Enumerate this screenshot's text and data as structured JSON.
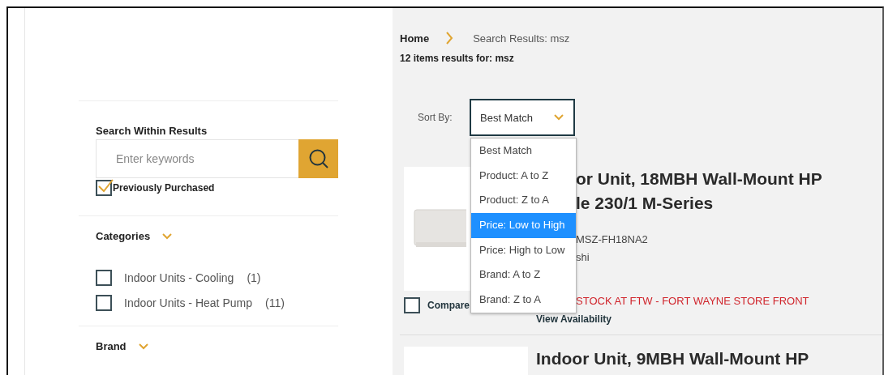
{
  "breadcrumb": [
    {
      "label": "Home",
      "kind": "link"
    },
    {
      "label": "Search Results: msz",
      "kind": "current"
    }
  ],
  "results_summary": "12 items results for: msz",
  "sidebar": {
    "search": {
      "title": "Search Within Results",
      "placeholder": "Enter keywords"
    },
    "previously_purchased": {
      "label": "Previously Purchased",
      "checked": true
    },
    "filters": [
      {
        "title": "Categories",
        "options": [
          {
            "label": "Indoor Units - Cooling",
            "count": "(1)",
            "checked": false
          },
          {
            "label": "Indoor Units - Heat Pump",
            "count": "(11)",
            "checked": false
          }
        ]
      },
      {
        "title": "Brand"
      }
    ]
  },
  "sort": {
    "label": "Sort By:",
    "value": "Best Match",
    "options": [
      {
        "label": "Best Match",
        "highlighted": false
      },
      {
        "label": "Product: A to Z",
        "highlighted": false
      },
      {
        "label": "Product: Z to A",
        "highlighted": false
      },
      {
        "label": "Price: Low to High",
        "highlighted": true
      },
      {
        "label": "Price: High to Low",
        "highlighted": false
      },
      {
        "label": "Brand: A to Z",
        "highlighted": false
      },
      {
        "label": "Brand: Z to A",
        "highlighted": false
      }
    ]
  },
  "products": [
    {
      "title_lines": [
        "or Unit, 18MBH Wall-Mount HP",
        "le 230/1 M-Series"
      ],
      "details": [
        "MSZ-FH18NA2",
        "shi"
      ],
      "stock": "STOCK AT FTW - FORT WAYNE STORE FRONT",
      "availability_link": "View Availability",
      "compare": {
        "label": "Compare",
        "checked": false
      }
    },
    {
      "title_lines": [
        "Indoor Unit, 9MBH Wall-Mount HP"
      ]
    }
  ]
}
